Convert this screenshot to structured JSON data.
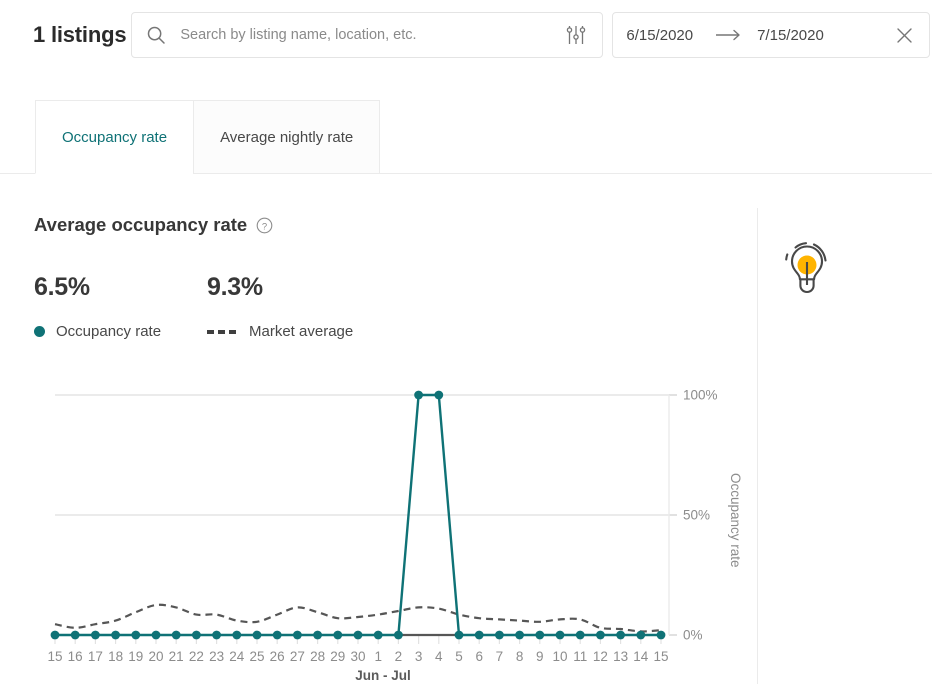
{
  "header": {
    "listings_count": "1 listings",
    "search": {
      "placeholder": "Search by listing name, location, etc.",
      "value": ""
    },
    "date_range": {
      "start": "6/15/2020",
      "end": "7/15/2020"
    }
  },
  "tabs": [
    {
      "label": "Occupancy rate",
      "active": true
    },
    {
      "label": "Average nightly rate",
      "active": false
    }
  ],
  "main": {
    "section_title": "Average occupancy rate",
    "stats": [
      {
        "value": "6.5%",
        "legend": "Occupancy rate",
        "marker": "dot",
        "color": "#0f7276"
      },
      {
        "value": "9.3%",
        "legend": "Market average",
        "marker": "dash",
        "color": "#3f3f3f"
      }
    ]
  },
  "colors": {
    "accent": "#0f7276",
    "market": "#565656",
    "grid": "#ebebeb",
    "axis_text": "#8c8c8c",
    "bulb": "#ffb400"
  },
  "chart_data": {
    "type": "line",
    "title": "Average occupancy rate",
    "xlabel": "Jun - Jul",
    "ylabel": "Occupancy rate",
    "ylim": [
      0,
      100
    ],
    "yticks": [
      0,
      50,
      100
    ],
    "ytick_labels": [
      "0%",
      "50%",
      "100%"
    ],
    "grid": true,
    "legend_position": "above-chart",
    "x": [
      "15",
      "16",
      "17",
      "18",
      "19",
      "20",
      "21",
      "22",
      "23",
      "24",
      "25",
      "26",
      "27",
      "28",
      "29",
      "30",
      "1",
      "2",
      "3",
      "4",
      "5",
      "6",
      "7",
      "8",
      "9",
      "10",
      "11",
      "12",
      "13",
      "14",
      "15"
    ],
    "x_axis_caption": "Jun - Jul",
    "series": [
      {
        "name": "Occupancy rate",
        "style": "solid",
        "color": "#0f7276",
        "markers": true,
        "values": [
          0,
          0,
          0,
          0,
          0,
          0,
          0,
          0,
          0,
          0,
          0,
          0,
          0,
          0,
          0,
          0,
          0,
          0,
          100,
          100,
          0,
          0,
          0,
          0,
          0,
          0,
          0,
          0,
          0,
          0,
          0
        ]
      },
      {
        "name": "Market average",
        "style": "dashed",
        "color": "#565656",
        "markers": false,
        "values": [
          4.5,
          3.0,
          4.5,
          6.0,
          9.5,
          12.5,
          11.5,
          8.5,
          8.5,
          6.0,
          5.5,
          8.5,
          11.5,
          9.5,
          7.0,
          7.5,
          8.5,
          10.0,
          11.5,
          11.0,
          8.5,
          7.0,
          6.5,
          6.0,
          5.5,
          6.5,
          6.5,
          3.0,
          2.5,
          1.5,
          2.0
        ]
      }
    ]
  }
}
